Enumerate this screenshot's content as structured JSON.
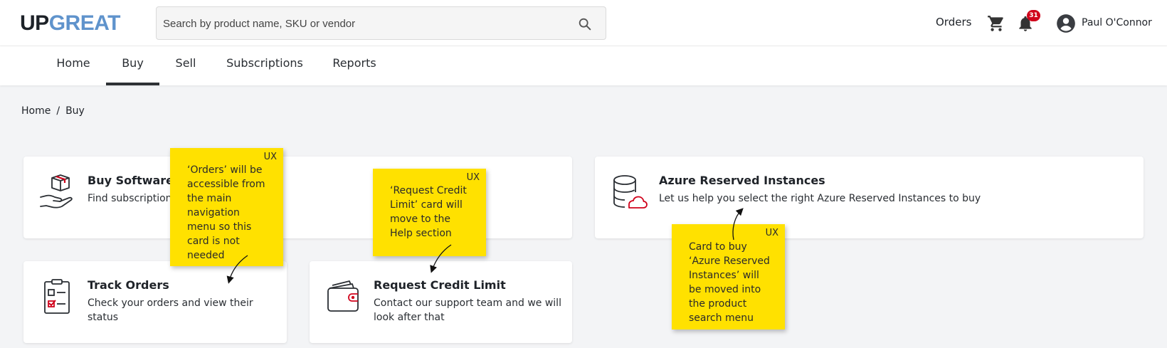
{
  "header": {
    "logo_up": "UP",
    "logo_great": "GREAT",
    "search_placeholder": "Search by product name, SKU or vendor",
    "orders_label": "Orders",
    "notification_count": "31",
    "user_name": "Paul O'Connor"
  },
  "nav": {
    "tabs": [
      {
        "label": "Home"
      },
      {
        "label": "Buy",
        "active": true
      },
      {
        "label": "Sell"
      },
      {
        "label": "Subscriptions"
      },
      {
        "label": "Reports"
      }
    ]
  },
  "breadcrumb": {
    "items": [
      "Home",
      "Buy"
    ],
    "separator": "/"
  },
  "cards": {
    "buy_software": {
      "title": "Buy Software",
      "desc": "Find subscriptions"
    },
    "azure": {
      "title": "Azure Reserved Instances",
      "desc": "Let us help you select the right Azure Reserved Instances to buy"
    },
    "track_orders": {
      "title": "Track Orders",
      "desc_line1": "Check your orders and view their",
      "desc_line2": "status"
    },
    "credit": {
      "title": "Request Credit Limit",
      "desc_line1": "Contact our support team and we will",
      "desc_line2": "look after that"
    }
  },
  "notes": {
    "orders": {
      "tag": "UX",
      "lines": [
        "‘Orders’ will be",
        "accessible from",
        "the main",
        "navigation",
        "menu so this",
        "card is not",
        "needed"
      ]
    },
    "credit": {
      "tag": "UX",
      "lines": [
        "‘Request Credit",
        "Limit’ card will",
        "move to the",
        "Help section"
      ]
    },
    "azure": {
      "tag": "UX",
      "lines": [
        "Card to buy",
        "‘Azure Reserved",
        "Instances’ will",
        "be moved into",
        "the product",
        "search menu"
      ]
    }
  },
  "colors": {
    "accent_red": "#d0021b",
    "sticky_yellow": "#ffe100",
    "logo_blue": "#5f93cc"
  }
}
